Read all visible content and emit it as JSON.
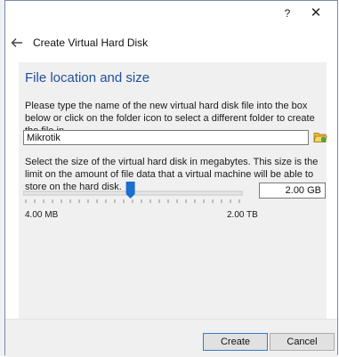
{
  "window": {
    "help_glyph": "?",
    "close_glyph": "✕"
  },
  "header": {
    "title": "Create Virtual Hard Disk"
  },
  "section": {
    "title": "File location and size"
  },
  "file_location": {
    "description": "Please type the name of the new virtual hard disk file into the box below or click on the folder icon to select a different folder to create the file in.",
    "value": "Mikrotik"
  },
  "size": {
    "description": "Select the size of the virtual hard disk in megabytes. This size is the limit on the amount of file data that a virtual machine will be able to store on the hard disk.",
    "value": "2.00 GB",
    "slider_min_label": "4.00 MB",
    "slider_max_label": "2.00 TB",
    "slider_position": 0.49
  },
  "buttons": {
    "create": "Create",
    "cancel": "Cancel"
  },
  "colors": {
    "section_title": "#1f4e9c",
    "slider_handle": "#1a6fcf",
    "create_border": "#2f7bd6"
  },
  "icons": {
    "back": "arrow-left-icon",
    "folder": "folder-icon"
  }
}
